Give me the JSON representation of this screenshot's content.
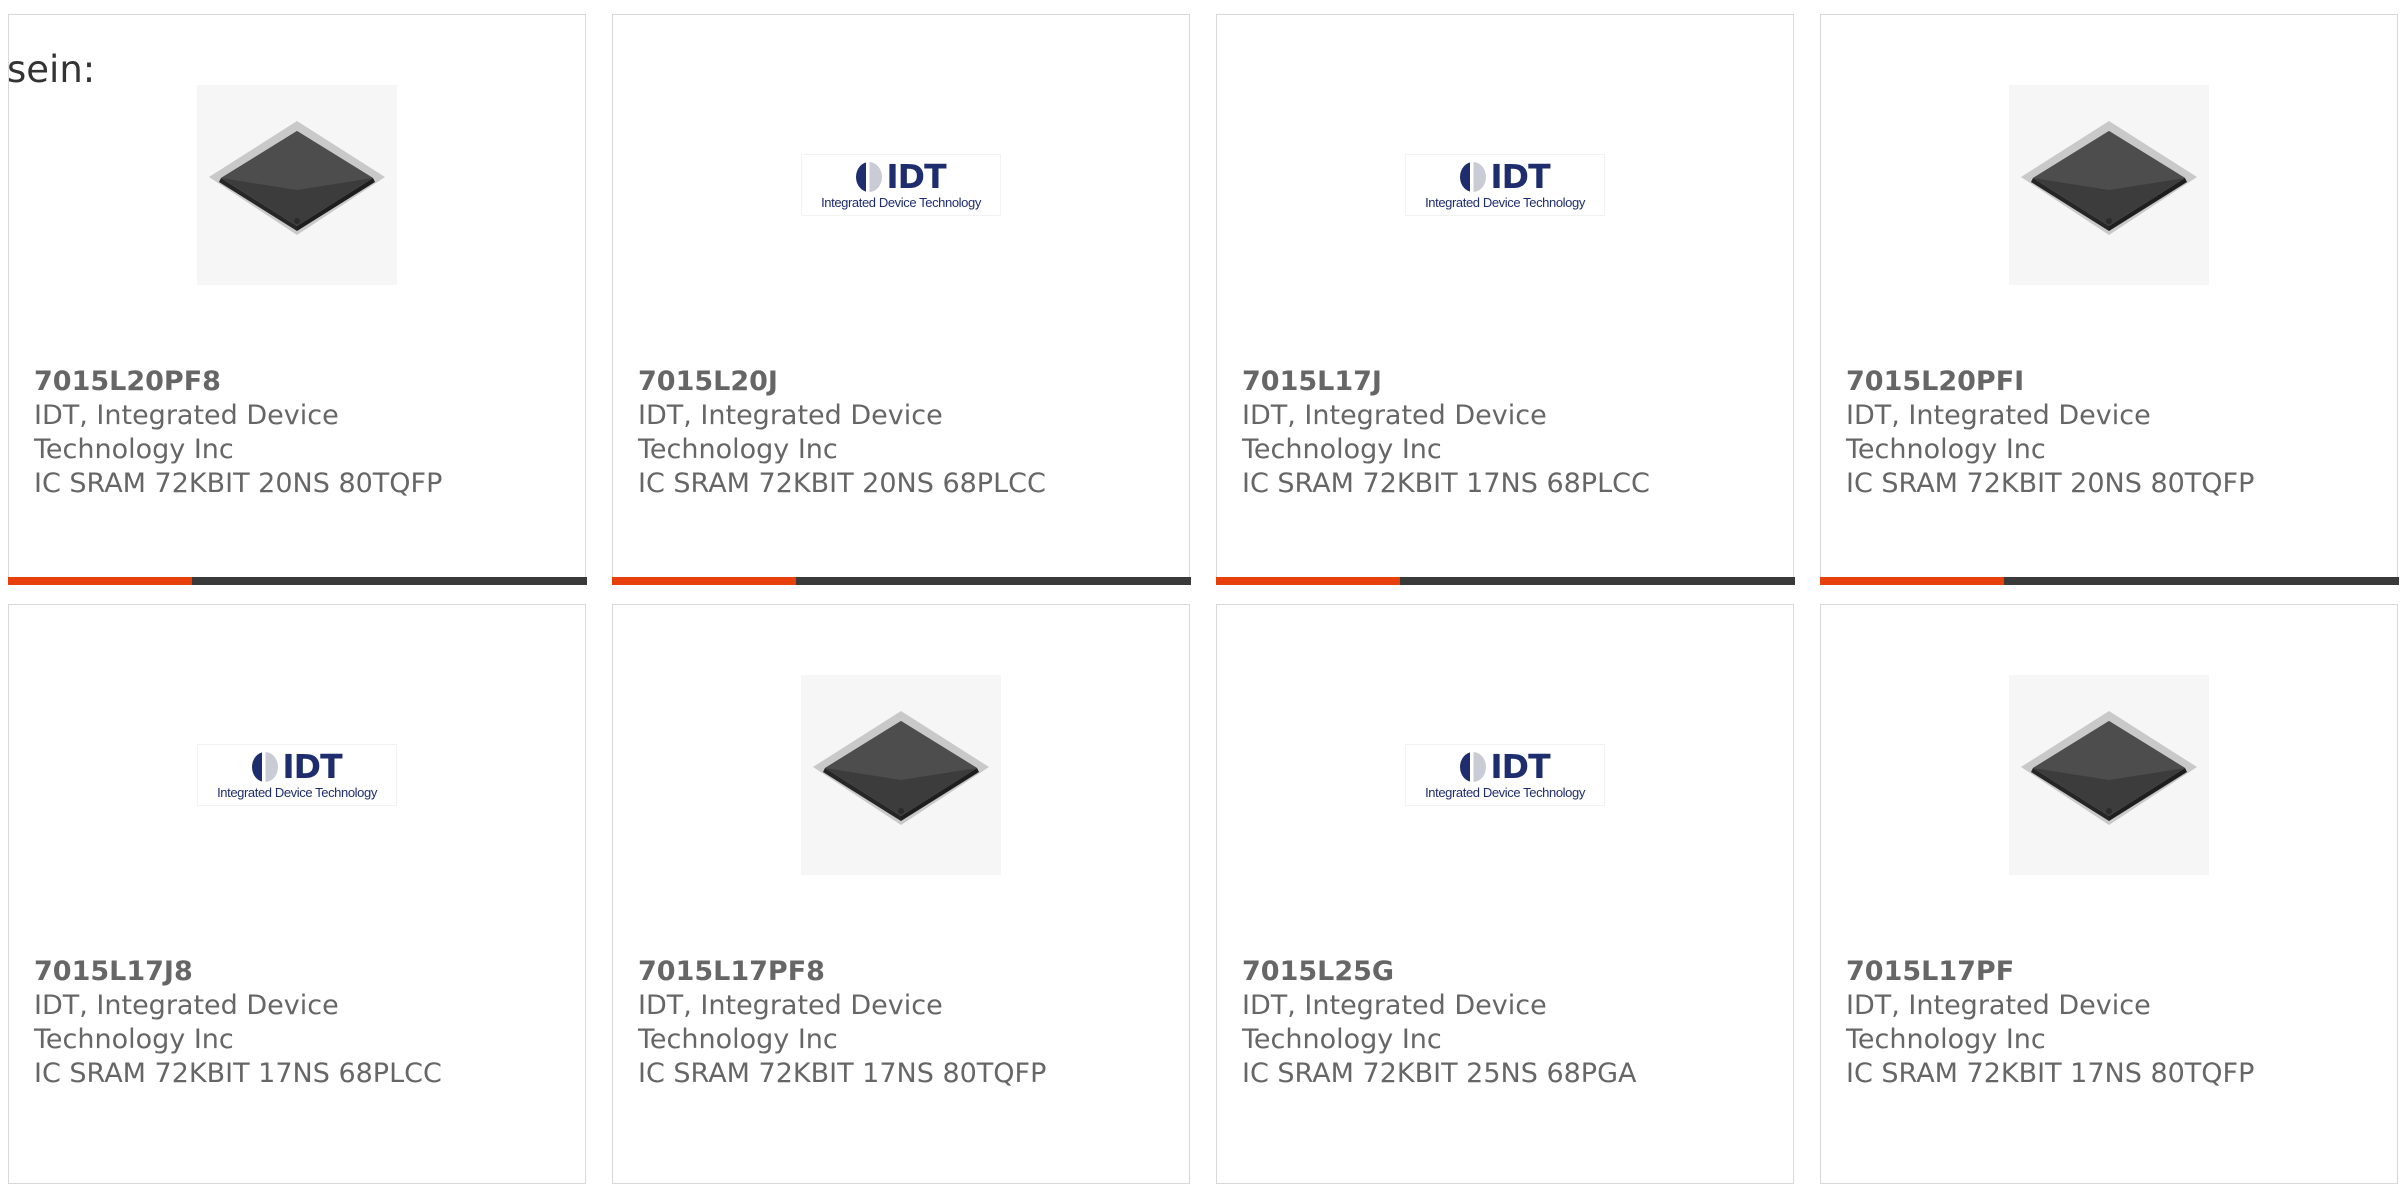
{
  "intro_text": "sein:",
  "colors": {
    "accent_red": "#e8400c",
    "accent_dark": "#3a3a3a",
    "text_gray": "#666666",
    "logo_navy": "#1e2d6e"
  },
  "logo": {
    "mark": "IDT",
    "tagline": "Integrated Device Technology"
  },
  "products": [
    {
      "part": "7015L20PF8",
      "maker_line1": "IDT, Integrated Device",
      "maker_line2": "Technology Inc",
      "desc": "IC SRAM 72KBIT 20NS 80TQFP",
      "image": "chip-photo"
    },
    {
      "part": "7015L20J",
      "maker_line1": "IDT, Integrated Device",
      "maker_line2": "Technology Inc",
      "desc": "IC SRAM 72KBIT 20NS 68PLCC",
      "image": "idt-logo"
    },
    {
      "part": "7015L17J",
      "maker_line1": "IDT, Integrated Device",
      "maker_line2": "Technology Inc",
      "desc": "IC SRAM 72KBIT 17NS 68PLCC",
      "image": "idt-logo"
    },
    {
      "part": "7015L20PFI",
      "maker_line1": "IDT, Integrated Device",
      "maker_line2": "Technology Inc",
      "desc": "IC SRAM 72KBIT 20NS 80TQFP",
      "image": "chip-photo"
    },
    {
      "part": "7015L17J8",
      "maker_line1": "IDT, Integrated Device",
      "maker_line2": "Technology Inc",
      "desc": "IC SRAM 72KBIT 17NS 68PLCC",
      "image": "idt-logo"
    },
    {
      "part": "7015L17PF8",
      "maker_line1": "IDT, Integrated Device",
      "maker_line2": "Technology Inc",
      "desc": "IC SRAM 72KBIT 17NS 80TQFP",
      "image": "chip-photo"
    },
    {
      "part": "7015L25G",
      "maker_line1": "IDT, Integrated Device",
      "maker_line2": "Technology Inc",
      "desc": "IC SRAM 72KBIT 25NS 68PGA",
      "image": "idt-logo"
    },
    {
      "part": "7015L17PF",
      "maker_line1": "IDT, Integrated Device",
      "maker_line2": "Technology Inc",
      "desc": "IC SRAM 72KBIT 17NS 80TQFP",
      "image": "chip-photo"
    }
  ]
}
